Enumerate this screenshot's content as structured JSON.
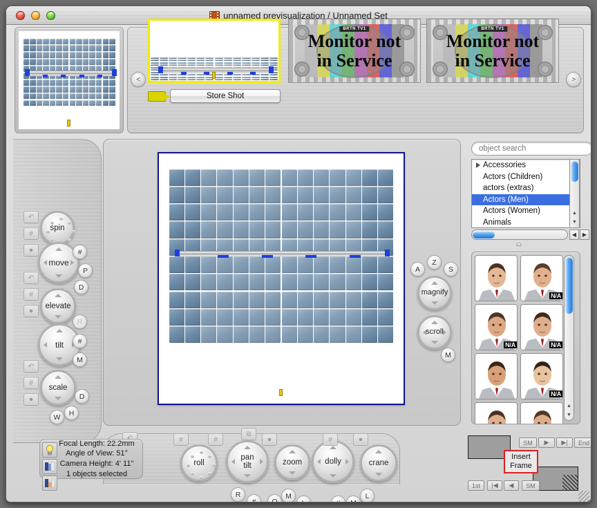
{
  "window": {
    "title": "unnamed previsualization / Unnamed Set",
    "title_icon": "filmstrip-icon",
    "traffic_lights": {
      "close": {
        "icon": "close-button",
        "color": "#e0483c"
      },
      "minimize": {
        "icon": "minimize-button",
        "color": "#f0a52c"
      },
      "maximize": {
        "icon": "maximize-button",
        "color": "#5fc034"
      }
    }
  },
  "storyboard": {
    "prev_label": "<",
    "next_label": ">",
    "store_shot_label": "Store Shot",
    "camera_icon": "video-camera-icon",
    "slots": [
      {
        "name": "live-preview",
        "kind": "floorplan",
        "selected": true
      },
      {
        "name": "shot-2",
        "kind": "testcard",
        "line1": "Monitor not",
        "line2": "in Service",
        "station": "BRTN TV1"
      },
      {
        "name": "shot-3",
        "kind": "testcard",
        "line1": "Monitor not",
        "line2": "in Service",
        "station": "BRTN TV1"
      }
    ]
  },
  "left_controls": {
    "knobs": [
      {
        "label": "spin",
        "type": "dial"
      },
      {
        "label": "move",
        "type": "pad4",
        "side": [
          "#",
          "P",
          "D"
        ]
      },
      {
        "label": "elevate",
        "type": "padv"
      },
      {
        "label": "tilt",
        "type": "pad4",
        "side": [
          "R",
          "#",
          "M"
        ]
      },
      {
        "label": "scale",
        "type": "padv",
        "side": [
          "D",
          "H",
          "W"
        ]
      }
    ],
    "tab_glyphs": [
      "undo-icon",
      "#",
      "mouse-icon"
    ]
  },
  "viewport_controls": {
    "top_buttons": [
      "A",
      "Z",
      "S"
    ],
    "magnify_label": "magnify",
    "scroll_label": "scroll",
    "scroll_side": "M"
  },
  "camera_controls": {
    "knobs": [
      {
        "label": "roll",
        "type": "dial",
        "side": [
          "R"
        ]
      },
      {
        "label": "pan\ntilt",
        "line1": "pan",
        "line2": "tilt",
        "type": "pad4",
        "side": [
          "#",
          "Q",
          "M"
        ]
      },
      {
        "label": "zoom",
        "type": "padv",
        "side": [
          "L"
        ]
      },
      {
        "label": "dolly",
        "type": "pad4",
        "side": [
          "#",
          "M"
        ]
      },
      {
        "label": "crane",
        "type": "padv",
        "side": [
          "L"
        ]
      }
    ],
    "tab_glyphs": [
      "undo-icon",
      "#",
      "#",
      "duplicate-icon",
      "mouse-icon",
      "#",
      "mouse-icon"
    ]
  },
  "info_panel": {
    "focal_length": "Focal Length: 22.2mm",
    "angle_of_view": "Angle of View: 51°",
    "camera_height": "Camera Height: 4' 11\"",
    "selection": "1 objects selected",
    "mode_icons": [
      "lightbulb-icon",
      "wall-render-icon",
      "shaded-render-icon"
    ]
  },
  "browser": {
    "search_placeholder": "object search",
    "search_value": "",
    "more_label": "...",
    "categories": [
      {
        "label": "Accessories",
        "expandable": true,
        "selected": false
      },
      {
        "label": "Actors (Children)",
        "expandable": false,
        "selected": false
      },
      {
        "label": "actors (extras)",
        "expandable": false,
        "selected": false
      },
      {
        "label": "Actors (Men)",
        "expandable": false,
        "selected": true
      },
      {
        "label": "Actors (Women)",
        "expandable": false,
        "selected": false
      },
      {
        "label": "Animals",
        "expandable": false,
        "selected": false
      }
    ],
    "thumbnails": [
      {
        "name": "actor-1",
        "na": false,
        "skin": "#e6b795",
        "hair": "#4a3326"
      },
      {
        "name": "actor-2",
        "na": true,
        "skin": "#e3b08d",
        "hair": "#5a3d2b"
      },
      {
        "name": "actor-3",
        "na": true,
        "skin": "#dda882",
        "hair": "#4e3527"
      },
      {
        "name": "actor-4",
        "na": true,
        "skin": "#e0ae8b",
        "hair": "#40291c"
      },
      {
        "name": "actor-5",
        "na": false,
        "skin": "#d9a078",
        "hair": "#3b2619"
      },
      {
        "name": "actor-6",
        "na": true,
        "skin": "#e7c49f",
        "hair": "#30211a"
      },
      {
        "name": "actor-7",
        "na": false,
        "skin": "#e0ae8b",
        "hair": "#4a3326"
      },
      {
        "name": "actor-8",
        "na": false,
        "skin": "#ddab86",
        "hair": "#503726"
      }
    ],
    "na_badge": "N/A"
  },
  "playback": {
    "top_row": [
      "SM",
      "▶",
      "▶|",
      "End"
    ],
    "bottom_row": [
      "1st",
      "|◀",
      "◀",
      "SM"
    ],
    "tooltip_line1": "Insert",
    "tooltip_line2": "Frame",
    "tooltip_border_color": "#e02020"
  },
  "scene": {
    "grid_cols": 14,
    "grid_rows": 10,
    "tile_color": "#6d8ca8",
    "wall_color": "#f0f0f0",
    "handle_color": "#1f3fe0",
    "camera_marker_color": "#e9c908",
    "selection_border": "#14148c"
  }
}
